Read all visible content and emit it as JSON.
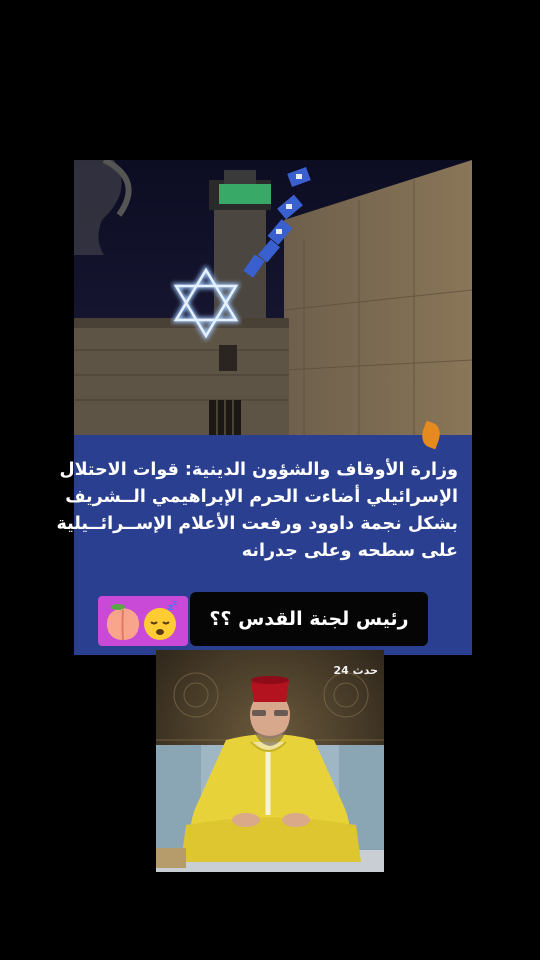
{
  "post": {
    "caption_lines": [
      "وزارة الأوقاف والشؤون الدينية: قوات الاحتلال",
      "الإسرائيلي أضاءت الحرم الإبراهيمي الــشريف",
      "بشكل نجمة داوود ورفعت الأعلام الإســرائــيلية",
      "على سطحه وعلى جدرانه"
    ],
    "question_text": "رئيس لجنة القدس ؟؟",
    "emojis": [
      "sleeping-face-emoji",
      "peach-emoji"
    ]
  },
  "bottom_image": {
    "channel_logo_text": "حدث 24"
  },
  "colors": {
    "caption_panel_bg": "#2a3f8f",
    "star_glow": "#9fc8ff",
    "flag_blue": "#3a5fcf",
    "emoji_box_bg": "#c94ad6",
    "robe_yellow": "#e8d23a",
    "fez_red": "#b3121f"
  }
}
